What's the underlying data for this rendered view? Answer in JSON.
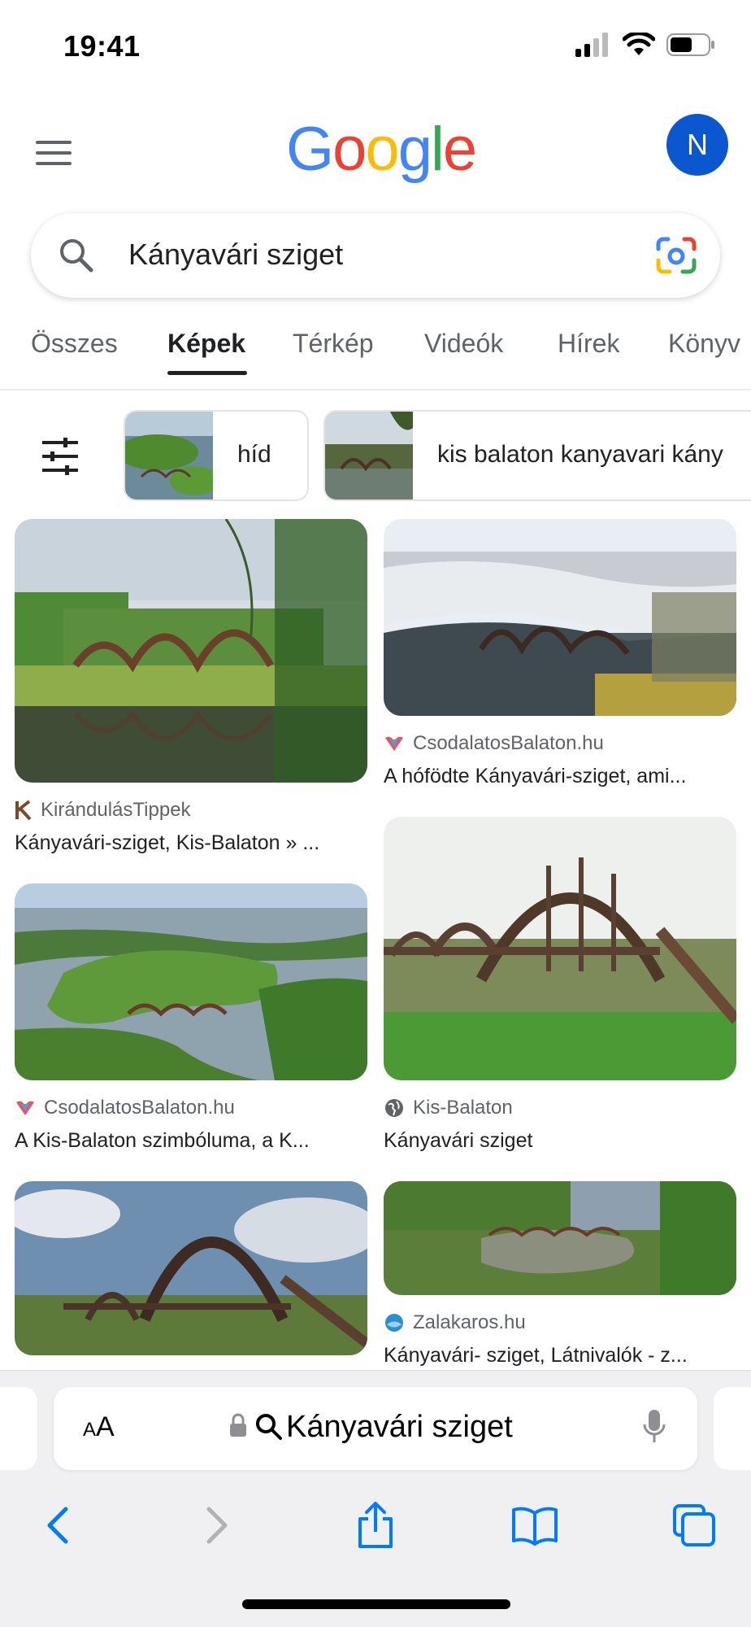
{
  "status_bar": {
    "time": "19:41"
  },
  "header": {
    "logo": "Google",
    "avatar_letter": "N"
  },
  "search": {
    "query": "Kányavári sziget"
  },
  "tabs": [
    "Összes",
    "Képek",
    "Térkép",
    "Videók",
    "Hírek",
    "Könyv"
  ],
  "chips": [
    "híd",
    "kis balaton kanyavari kány"
  ],
  "results": [
    {
      "source": "KirándulásTippek",
      "title": "Kányavári-sziget, Kis-Balaton » ..."
    },
    {
      "source": "CsodalatosBalaton.hu",
      "title": "A hófödte Kányavári-sziget, ami..."
    },
    {
      "source": "CsodalatosBalaton.hu",
      "title": "A Kis-Balaton szimbóluma, a K..."
    },
    {
      "source": "Kis-Balaton",
      "title": "Kányavári sziget"
    },
    {
      "source": "Zalakaros.hu",
      "title": "Kányavári- sziget, Látnivalók - z..."
    }
  ],
  "browser": {
    "aa_label_small": "A",
    "aa_label_big": "A",
    "address": "Kányavári sziget"
  },
  "colors": {
    "google_blue": "#4285F4",
    "google_red": "#EA4335",
    "google_yellow": "#FBBC05",
    "google_green": "#34A853",
    "avatar": "#0b57d0",
    "safari_blue": "#007aff"
  }
}
